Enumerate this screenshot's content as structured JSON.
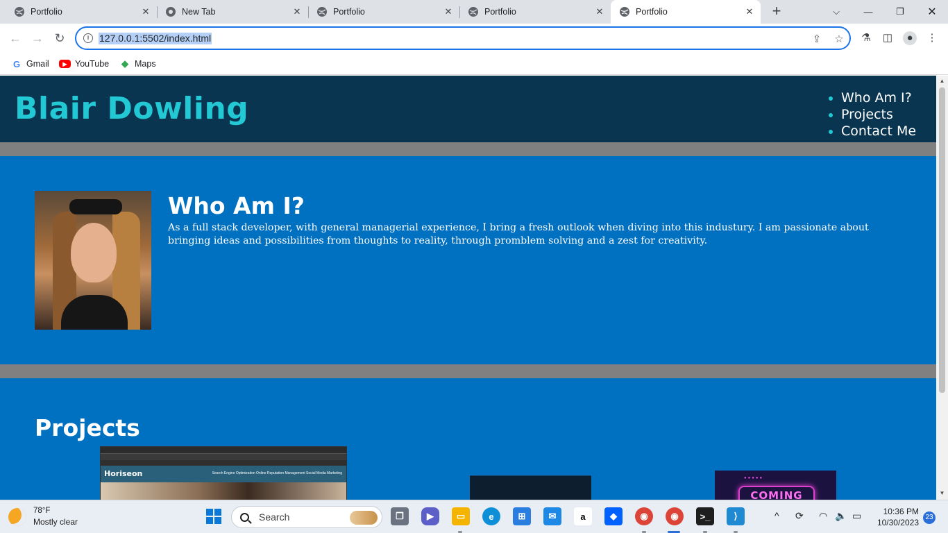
{
  "browser": {
    "tabs": [
      {
        "title": "Portfolio",
        "active": false
      },
      {
        "title": "New Tab",
        "active": false
      },
      {
        "title": "Portfolio",
        "active": false
      },
      {
        "title": "Portfolio",
        "active": false
      },
      {
        "title": "Portfolio",
        "active": true
      }
    ],
    "url": "127.0.0.1:5502/index.html",
    "bookmarks": [
      {
        "label": "Gmail",
        "icon": "google-icon"
      },
      {
        "label": "YouTube",
        "icon": "youtube-icon"
      },
      {
        "label": "Maps",
        "icon": "maps-icon"
      }
    ]
  },
  "site": {
    "title": "Blair Dowling",
    "nav": [
      "Who Am I?",
      "Projects",
      "Contact Me"
    ],
    "about": {
      "heading": "Who Am I?",
      "text": "As a full stack developer, with general managerial experience, I bring a fresh outlook when diving into this industury. I am passionate about bringing ideas and possibilities from thoughts to reality, through promblem solving and a zest for creativity."
    },
    "projects": {
      "heading": "Projects",
      "project1_brand": "Horiseon",
      "project1_nav": "Search Engine Optimization   Online Reputation Management   Social Media Marketing",
      "project3_sign": "COMING"
    }
  },
  "taskbar": {
    "weather_temp": "78°F",
    "weather_desc": "Mostly clear",
    "search_label": "Search",
    "time": "10:36 PM",
    "date": "10/30/2023",
    "notifications": "23"
  },
  "colors": {
    "header_bg": "#0a3550",
    "title_accent": "#22c8d4",
    "section_bg": "#0070c0",
    "divider": "#808080"
  }
}
